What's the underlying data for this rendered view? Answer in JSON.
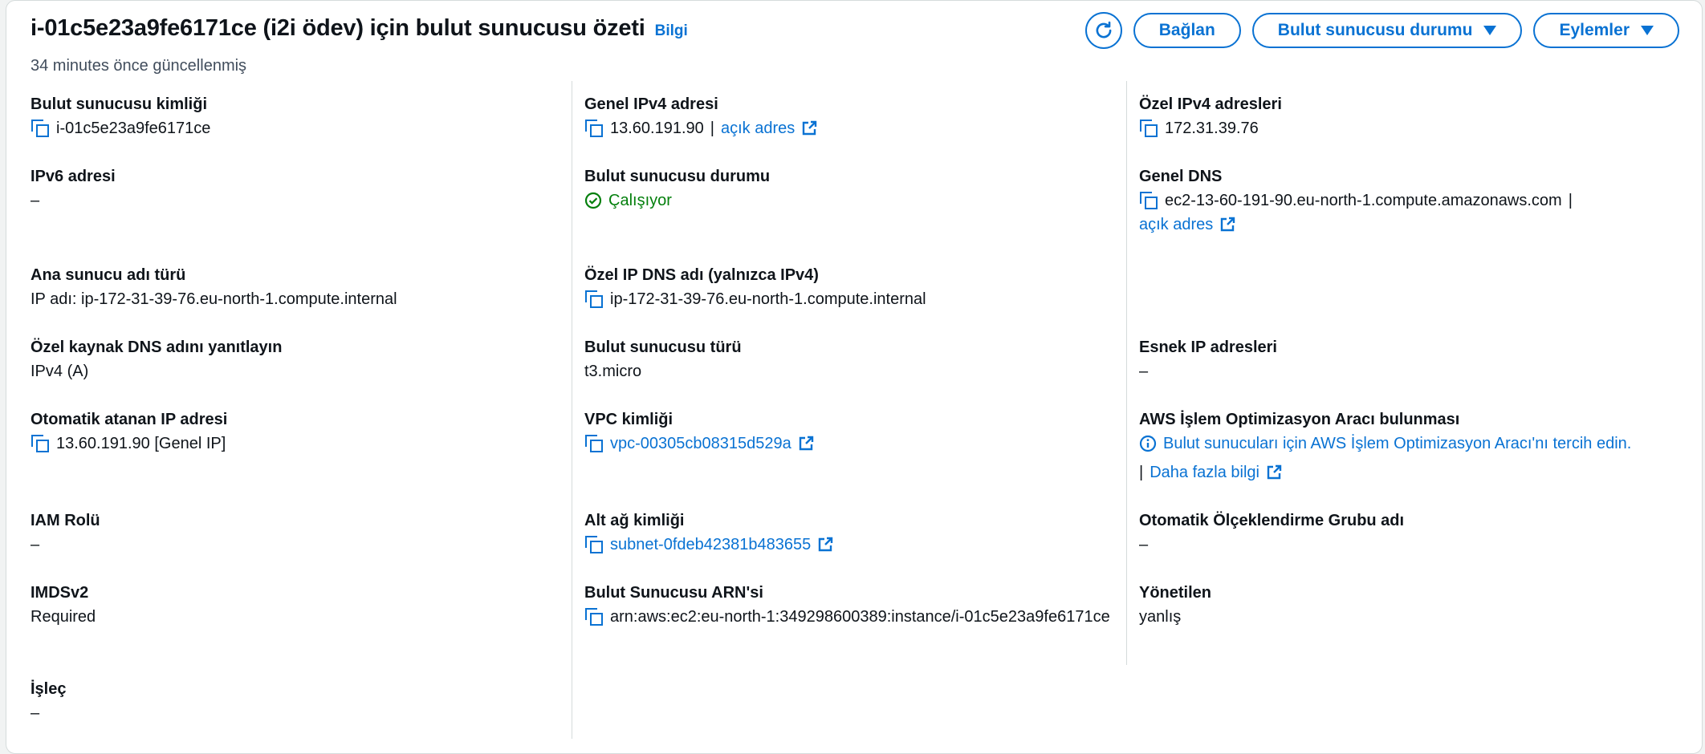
{
  "header": {
    "title": "i-01c5e23a9fe6171ce (i2i ödev) için bulut sunucusu özeti",
    "info_link": "Bilgi",
    "updated": "34 minutes önce güncellenmiş",
    "buttons": {
      "connect": "Bağlan",
      "instance_state": "Bulut sunucusu durumu",
      "actions": "Eylemler"
    }
  },
  "col1": {
    "instance_id_label": "Bulut sunucusu kimliği",
    "instance_id_value": "i-01c5e23a9fe6171ce",
    "ipv6_label": "IPv6 adresi",
    "ipv6_value": "–",
    "hostname_type_label": "Ana sunucu adı türü",
    "hostname_type_value": "IP adı: ip-172-31-39-76.eu-north-1.compute.internal",
    "resource_dns_label": "Özel kaynak DNS adını yanıtlayın",
    "resource_dns_value": "IPv4 (A)",
    "auto_ip_label": "Otomatik atanan IP adresi",
    "auto_ip_value": "13.60.191.90 [Genel IP]",
    "iam_label": "IAM Rolü",
    "iam_value": "–",
    "imds_label": "IMDSv2",
    "imds_value": "Required",
    "operator_label": "İşleç",
    "operator_value": "–"
  },
  "col2": {
    "public_ipv4_label": "Genel IPv4 adresi",
    "public_ipv4_value": "13.60.191.90",
    "separator": "|",
    "open_address": "açık adres",
    "state_label": "Bulut sunucusu durumu",
    "state_value": "Çalışıyor",
    "private_dns_label": "Özel IP DNS adı (yalnızca IPv4)",
    "private_dns_value": "ip-172-31-39-76.eu-north-1.compute.internal",
    "type_label": "Bulut sunucusu türü",
    "type_value": "t3.micro",
    "vpc_label": "VPC kimliği",
    "vpc_value": "vpc-00305cb08315d529a",
    "subnet_label": "Alt ağ kimliği",
    "subnet_value": "subnet-0fdeb42381b483655",
    "arn_label": "Bulut Sunucusu ARN'si",
    "arn_value": "arn:aws:ec2:eu-north-1:349298600389:instance/i-01c5e23a9fe6171ce"
  },
  "col3": {
    "private_ipv4_label": "Özel IPv4 adresleri",
    "private_ipv4_value": "172.31.39.76",
    "public_dns_label": "Genel DNS",
    "public_dns_value": "ec2-13-60-191-90.eu-north-1.compute.amazonaws.com",
    "separator": "|",
    "open_address": "açık adres",
    "elastic_ip_label": "Esnek IP adresleri",
    "elastic_ip_value": "–",
    "optimizer_label": "AWS İşlem Optimizasyon Aracı bulunması",
    "optimizer_value": "Bulut sunucuları için AWS İşlem Optimizasyon Aracı'nı tercih edin.",
    "learn_more": "Daha fazla bilgi",
    "asg_label": "Otomatik Ölçeklendirme Grubu adı",
    "asg_value": "–",
    "managed_label": "Yönetilen",
    "managed_value": "yanlış"
  },
  "colors": {
    "link": "#0972d3",
    "success": "#037f0c",
    "text": "#0f141a",
    "divider": "#d5dbdb"
  },
  "icons": [
    "refresh-icon",
    "caret-down-icon",
    "copy-icon",
    "external-link-icon",
    "check-circle-icon",
    "info-circle-icon"
  ]
}
